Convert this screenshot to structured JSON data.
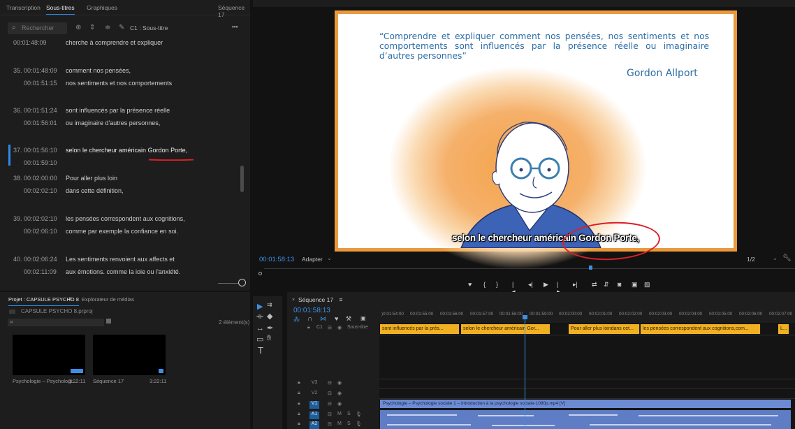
{
  "captions_panel": {
    "tabs": [
      "Transcription",
      "Sous-titres",
      "Graphiques"
    ],
    "sequence_label": "Séquence 17",
    "search_placeholder": "Rechercher",
    "track_label": "C1 : Sous-titre",
    "more_label": "•••",
    "items": [
      {
        "num": "",
        "in": "",
        "out": "00:01:48:09",
        "line1": "cherche à comprendre et expliquer",
        "line2": ""
      },
      {
        "num": "35.",
        "in": "00:01:48:09",
        "out": "00:01:51:15",
        "line1": "comment nos pensées,",
        "line2": "nos sentiments et nos comportements"
      },
      {
        "num": "36.",
        "in": "00:01:51:24",
        "out": "00:01:56:01",
        "line1": "sont influencés par la présence réelle",
        "line2": "ou imaginaire d'autres personnes,"
      },
      {
        "num": "37.",
        "in": "00:01:56:10",
        "out": "00:01:59:10",
        "line1": "selon le chercheur américain Gordon Porte,",
        "line2": ""
      },
      {
        "num": "38.",
        "in": "00:02:00:00",
        "out": "00:02:02:10",
        "line1": "Pour aller plus loin",
        "line2": "dans cette définition,"
      },
      {
        "num": "39.",
        "in": "00:02:02:10",
        "out": "00:02:06:10",
        "line1": "les pensées correspondent aux cognitions,",
        "line2": "comme par exemple la confiance en soi."
      },
      {
        "num": "40.",
        "in": "00:02:06:24",
        "out": "00:02:11:09",
        "line1": "Les sentiments renvoient aux affects et",
        "line2": "aux émotions, comme la joie ou l'anxiété."
      }
    ]
  },
  "monitor": {
    "quote": "“Comprendre et expliquer comment nos pensées, nos sentiments et nos comportements sont influencés par la présence réelle ou imaginaire d’autres personnes”",
    "author": "Gordon Allport",
    "subtitle": "selon le chercheur américain Gordon Porte,",
    "timecode": "00:01:58:13",
    "fit": "Adapter",
    "resolution": "1/2",
    "transport": [
      "♥",
      "{",
      "}",
      "|◂",
      "◂|",
      "▶",
      "|▸",
      "▸|",
      "⇄",
      "⇵",
      "◙",
      "▣",
      "▨"
    ]
  },
  "project_panel": {
    "tab_active": "Projet : CAPSULE PSYCHO 8",
    "tab_menu": "≡",
    "tab_other": "Explorateur de médias",
    "path": "CAPSULE PSYCHO 8.prproj",
    "count": "2 élément(s)",
    "items": [
      {
        "name": "Psychologie – Psychologi...",
        "duration": "3:22:11"
      },
      {
        "name": "Séquence 17",
        "duration": "3:22:11"
      }
    ]
  },
  "timeline": {
    "tab": "Séquence 17",
    "tab_menu": "≡",
    "timecode": "00:01:58:13",
    "ruler": [
      ")0:01:54:00",
      "00:01:55:00",
      "00:01:56:00",
      "00:01:57:00",
      "00:01:58:00",
      "00:01:59:00",
      "00:02:00:00",
      "00:02:01:00",
      "00:02:02:00",
      "00:02:03:00",
      "00:02:04:00",
      "00:02:05:00",
      "00:02:06:00",
      "00:02:07:00"
    ],
    "caption_track": "Sous-titre",
    "caption_track_id": "C1",
    "caption_clips": [
      "sont influencés par la prés...",
      "selon le chercheur américain Gor...",
      "Pour aller plus loindans cet...",
      "les pensées correspondent aux cognitions,com...",
      "L..."
    ],
    "video_tracks": [
      "V3",
      "V2",
      "V1"
    ],
    "audio_tracks": [
      "A1",
      "A2"
    ],
    "audio_flags": [
      "M",
      "S"
    ],
    "video_clip": "Psychologie – Psychologie sociale 1 – Introduction à la psychologie sociale-1080p.mp4 [V]"
  },
  "colors": {
    "accent": "#2d8ceb",
    "caption_clip": "#f0b021",
    "video_clip": "#6d8bd3",
    "frame_border": "#ea9a3c",
    "quote_text": "#2d6ea7",
    "annotation": "#d9202a"
  }
}
